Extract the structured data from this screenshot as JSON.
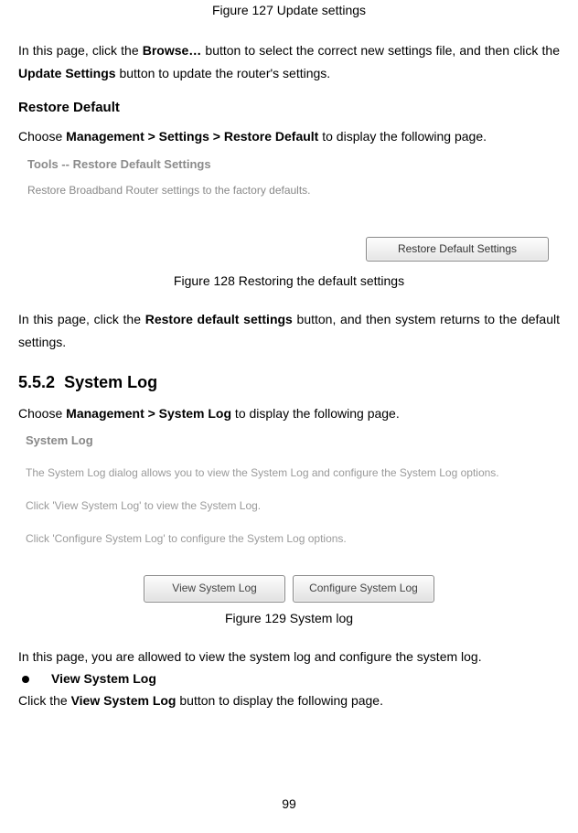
{
  "caption127": "Figure 127 Update settings",
  "para1_a": "In this page, click the ",
  "para1_b": "Browse…",
  "para1_c": " button to select the correct new settings file, and then click the ",
  "para1_d": "Update Settings",
  "para1_e": " button to update the router's settings.",
  "restore_heading": "Restore Default",
  "restore_para_a": "Choose ",
  "restore_para_b": "Management > Settings > Restore Default",
  "restore_para_c": " to display the following page.",
  "tools_title": "Tools -- Restore Default Settings",
  "tools_desc": "Restore Broadband Router settings to the factory defaults.",
  "restore_btn": "Restore Default Settings",
  "caption128": "Figure 128 Restoring the default settings",
  "para2_a": "In this page, click the ",
  "para2_b": "Restore default settings",
  "para2_c": " button, and then system returns to the default settings.",
  "section_num": "5.5.2",
  "section_title": "System Log",
  "syslog_para_a": "Choose ",
  "syslog_para_b": "Management > System Log",
  "syslog_para_c": " to display the following page.",
  "syslog_title": "System Log",
  "syslog_text1": "The System Log dialog allows you to view the System Log and configure the System Log options.",
  "syslog_text2": "Click 'View System Log' to view the System Log.",
  "syslog_text3": "Click 'Configure System Log' to configure the System Log options.",
  "view_btn": "View System Log",
  "config_btn": "Configure System Log",
  "caption129": "Figure 129 System log",
  "para3": "In this page, you are allowed to view the system log and configure the system log.",
  "bullet_label": "View System Log",
  "para4_a": "Click the ",
  "para4_b": "View System Log",
  "para4_c": " button to display the following page.",
  "page_num": "99"
}
